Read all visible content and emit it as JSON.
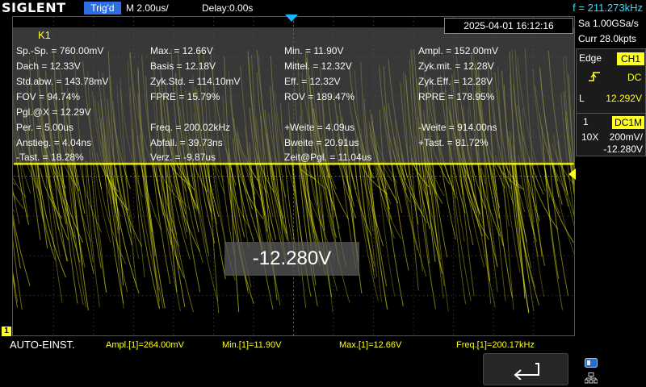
{
  "header": {
    "brand": "SIGLENT",
    "trigger_status": "Trig'd",
    "timebase": "M 2.00us/",
    "delay": "Delay:0.00s",
    "frequency_counter": "f = 211.273kHz"
  },
  "datetime": "2025-04-01 16:12:16",
  "measurements": {
    "title": "K1",
    "rows": [
      [
        "Sp.-Sp. = 760.00mV",
        "Max. = 12.66V",
        "Min. = 11.90V",
        "Ampl. = 152.00mV"
      ],
      [
        "Dach = 12.33V",
        "Basis = 12.18V",
        "Mittel. = 12.32V",
        "Zyk.mit. = 12.28V"
      ],
      [
        "Std.abw. = 143.78mV",
        "Zyk.Std. = 114.10mV",
        "Eff. = 12.32V",
        "Zyk.Eff. = 12.28V"
      ],
      [
        "FOV = 94.74%",
        "FPRE = 15.79%",
        "ROV = 189.47%",
        "RPRE = 178.95%"
      ],
      [
        "Pgl.@X = 12.29V",
        "",
        "",
        ""
      ],
      [
        "Per. = 5.00us",
        "Freq. = 200.02kHz",
        "+Weite = 4.09us",
        "-Weite = 914.00ns"
      ],
      [
        "Anstieg. = 4.04ns",
        "Abfall. = 39.73ns",
        "Bweite = 20.91us",
        "+Tast. = 81.72%"
      ],
      [
        "-Tast. = 18.28%",
        "Verz. = -9.87us",
        "Zeit@Pgl. = 11.04us",
        ""
      ]
    ]
  },
  "big_readout": "-12.280V",
  "sidepanel": {
    "sample_rate": "Sa 1.00GSa/s",
    "memory": "Curr 28.0kpts",
    "trigger_type": "Edge",
    "trigger_source": "CH1",
    "trigger_coupling": "DC",
    "trigger_level_label": "L",
    "trigger_level": "12.292V",
    "channel_number": "1",
    "channel_coupling": "DC1M",
    "probe": "10X",
    "vdiv": "200mV/",
    "offset": "-12.280V"
  },
  "ch1_marker": "1",
  "bottom": {
    "auto_label": "AUTO-EINST.",
    "measurements": [
      "Ampl.[1]=264.00mV",
      "Min.[1]=11.90V",
      "Max.[1]=12.66V",
      "Freq.[1]=200.17kHz"
    ]
  },
  "colors": {
    "trace": "#ffff22",
    "accent_cyan": "#25e4ff",
    "trig_badge": "#2d6fe0",
    "grid": "#4a4a4a"
  },
  "icons": {
    "back": "back-arrow-icon",
    "sd": "sd-card-icon",
    "network": "network-icon",
    "edge": "rising-edge-icon"
  }
}
